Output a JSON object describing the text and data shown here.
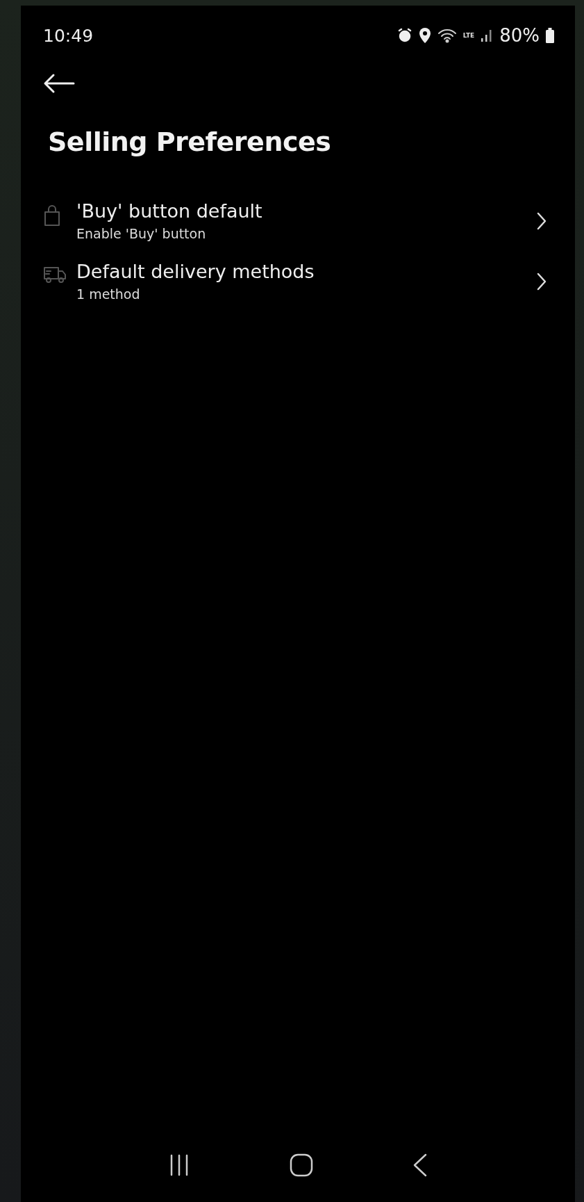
{
  "status_bar": {
    "time": "10:49",
    "network_label": "LTE",
    "battery": "80%"
  },
  "title": "Selling Preferences",
  "items": [
    {
      "kind": "bag",
      "title": "'Buy' button default",
      "subtitle": "Enable 'Buy' button"
    },
    {
      "kind": "van",
      "title": "Default delivery methods",
      "subtitle": "1 method"
    }
  ]
}
